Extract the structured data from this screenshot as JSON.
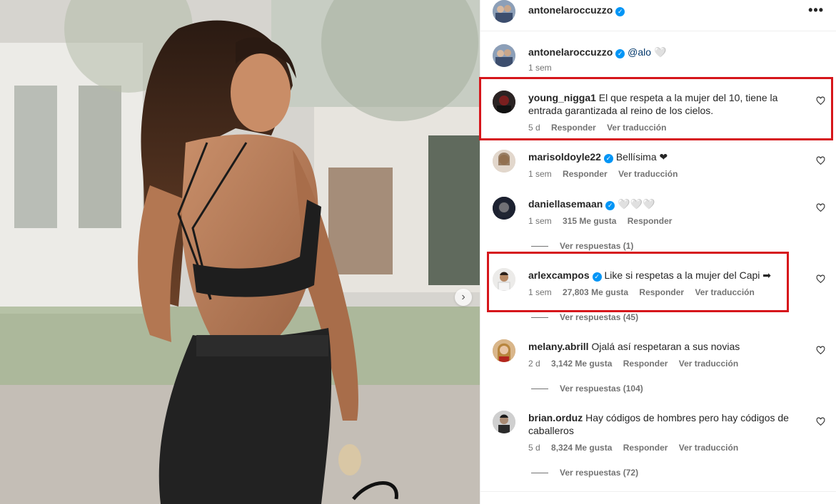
{
  "post": {
    "author": "antonelaroccuzzo",
    "caption_mention": "@alo",
    "caption_tail": "🤍",
    "caption_time": "1 sem",
    "more_icon": "more-horizontal-icon",
    "next_icon": "chevron-right-icon"
  },
  "comments": [
    {
      "username": "young_nigga1",
      "verified": false,
      "text": "El que respeta a la mujer del 10, tiene la entrada garantizada al reino de los cielos.",
      "time": "5 d",
      "likes": "",
      "reply": "Responder",
      "translate": "Ver traducción",
      "replies": ""
    },
    {
      "username": "marisoldoyle22",
      "verified": true,
      "text": "Bellísima ❤",
      "time": "1 sem",
      "likes": "",
      "reply": "Responder",
      "translate": "Ver traducción",
      "replies": ""
    },
    {
      "username": "daniellasemaan",
      "verified": true,
      "text": "🤍🤍🤍",
      "time": "1 sem",
      "likes": "315 Me gusta",
      "reply": "Responder",
      "translate": "",
      "replies": "Ver respuestas (1)"
    },
    {
      "username": "arlexcampos",
      "verified": true,
      "text": "Like si respetas a la mujer del Capi ➡",
      "time": "1 sem",
      "likes": "27,803 Me gusta",
      "reply": "Responder",
      "translate": "Ver traducción",
      "replies": "Ver respuestas (45)"
    },
    {
      "username": "melany.abrill",
      "verified": false,
      "text": "Ojalá así respetaran a sus novias",
      "time": "2 d",
      "likes": "3,142 Me gusta",
      "reply": "Responder",
      "translate": "Ver traducción",
      "replies": "Ver respuestas (104)"
    },
    {
      "username": "brian.orduz",
      "verified": false,
      "text": "Hay códigos de hombres pero hay códigos de caballeros",
      "time": "5 d",
      "likes": "8,324 Me gusta",
      "reply": "Responder",
      "translate": "Ver traducción",
      "replies": "Ver respuestas (72)"
    }
  ],
  "colors": {
    "highlight": "#d6161b",
    "verified": "#0095f6",
    "secondary_text": "#737373"
  }
}
